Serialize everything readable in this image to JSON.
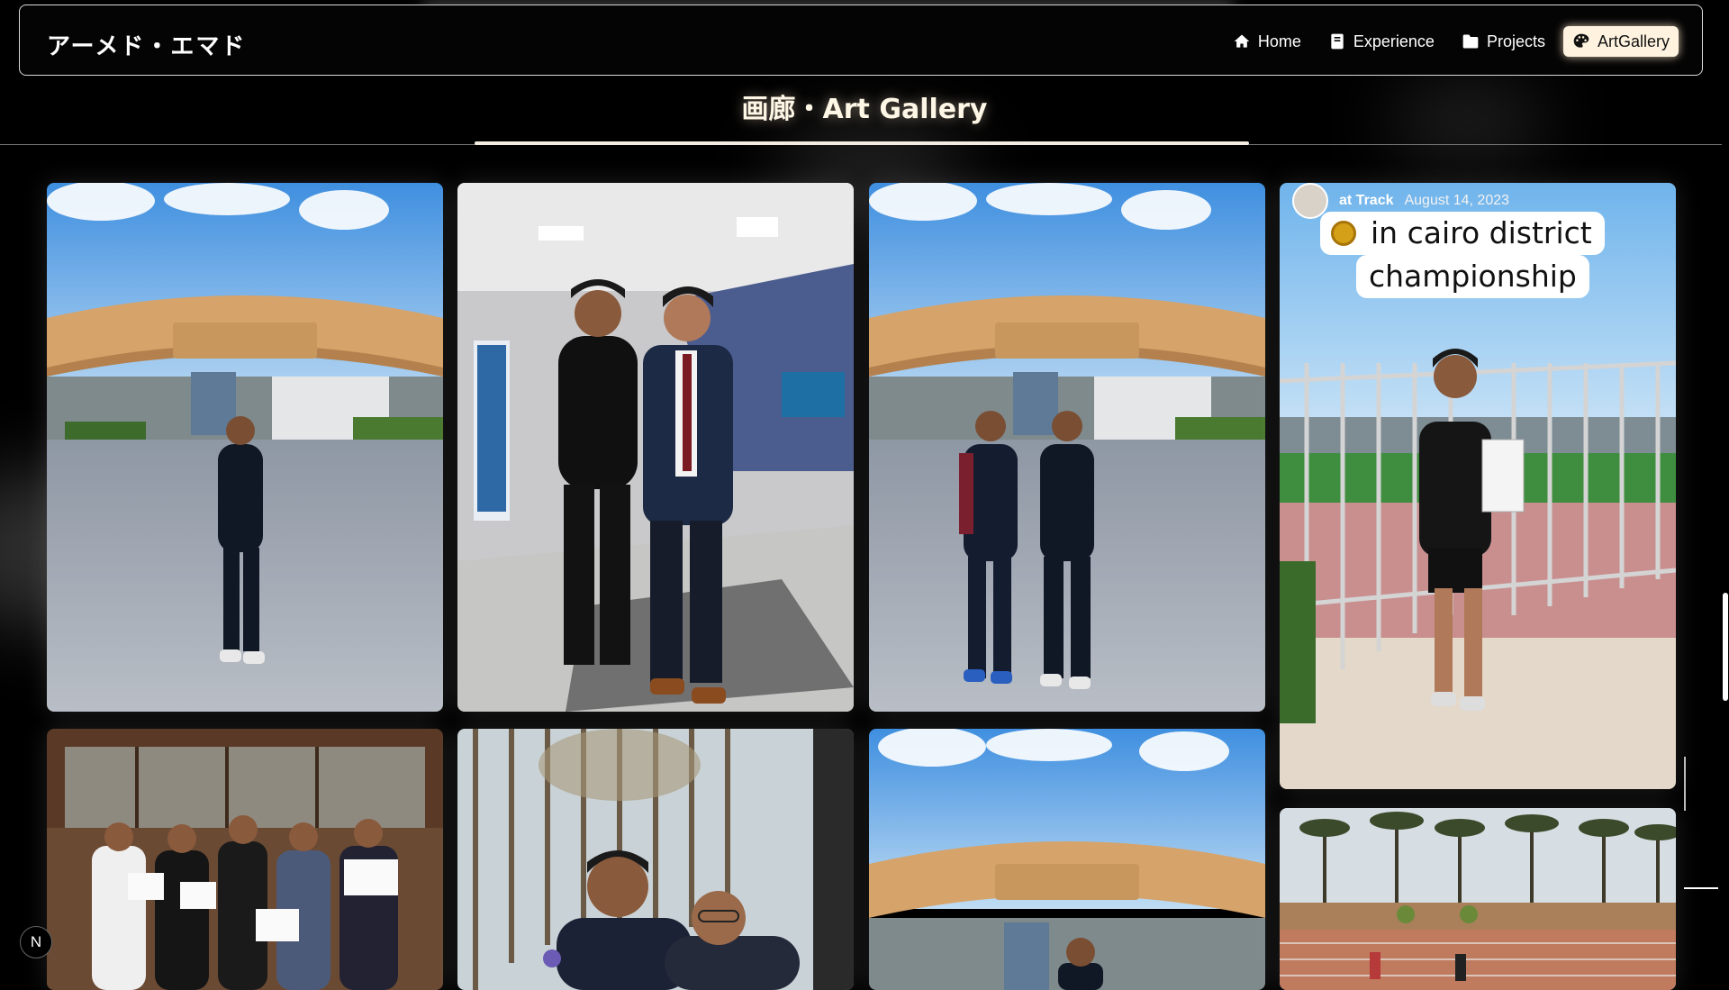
{
  "brand": "アーメド・エマド",
  "nav": {
    "items": [
      {
        "label": "Home",
        "icon": "home-icon"
      },
      {
        "label": "Experience",
        "icon": "book-icon"
      },
      {
        "label": "Projects",
        "icon": "folder-icon"
      },
      {
        "label": "ArtGallery",
        "icon": "palette-icon",
        "active": true
      }
    ]
  },
  "page_title": "画廊・Art Gallery",
  "story_overlay": {
    "user": "at Track",
    "date": "August 14, 2023",
    "sticker_line1": "in cairo district",
    "sticker_line2": "championship"
  },
  "corner_badge": "N",
  "colors": {
    "background": "#000000",
    "accent": "#fff3e0",
    "nav_border": "#d9d9d9"
  }
}
